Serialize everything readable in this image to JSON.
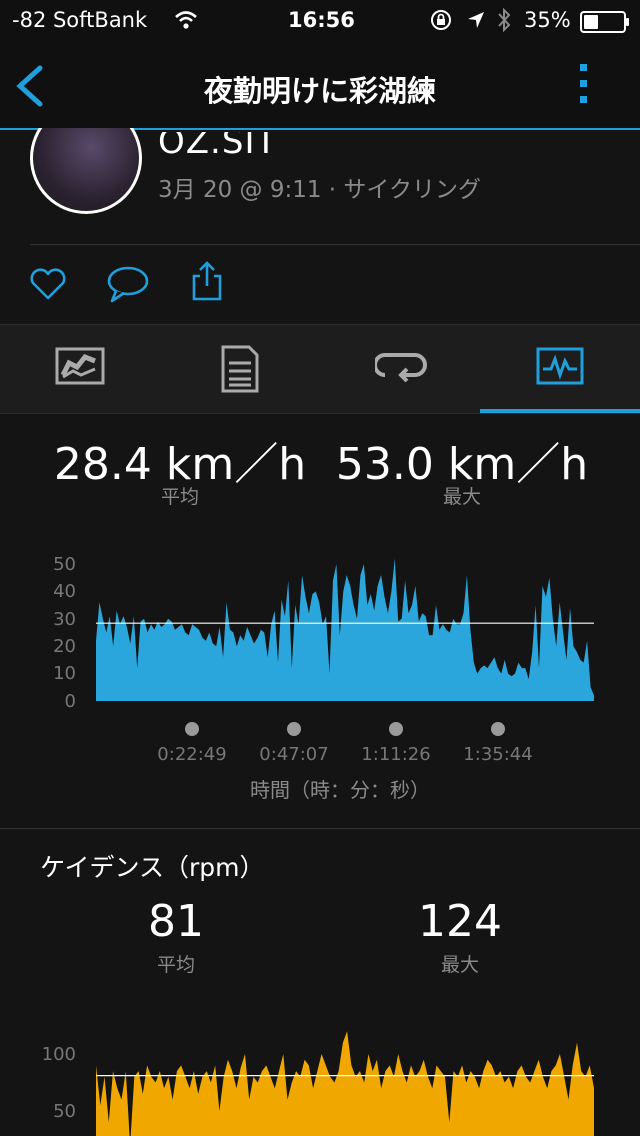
{
  "status_bar": {
    "carrier": "-82 SoftBank",
    "time": "16:56",
    "battery": "35%"
  },
  "nav": {
    "title": "夜勤明けに彩湖練"
  },
  "activity": {
    "user_name": "OZ.SIT",
    "meta": "3月 20 @ 9:11 · サイクリング"
  },
  "tabs": [
    "summary",
    "details",
    "laps",
    "charts"
  ],
  "speed": {
    "avg_value": "28.4 km／h",
    "avg_label": "平均",
    "max_value": "53.0 km／h",
    "max_label": "最大",
    "y_ticks": [
      "50",
      "40",
      "30",
      "20",
      "10",
      "0"
    ],
    "x_ticks": [
      "0:22:49",
      "0:47:07",
      "1:11:26",
      "1:35:44"
    ],
    "x_axis_label": "時間（時：分：秒）",
    "color": "#2aa6dc"
  },
  "cadence": {
    "title": "ケイデンス（rpm）",
    "avg_value": "81",
    "avg_label": "平均",
    "max_value": "124",
    "max_label": "最大",
    "y_ticks": [
      "100",
      "50"
    ],
    "color": "#f0a800"
  },
  "chart_data": [
    {
      "type": "area",
      "xlabel": "時間（時：分：秒）",
      "ylabel": "",
      "ylim": [
        0,
        55
      ],
      "x_ticks": [
        "0:22:49",
        "0:47:07",
        "1:11:26",
        "1:35:44"
      ],
      "average_line": 28.4,
      "y": [
        22,
        36,
        30,
        25,
        31,
        20,
        33,
        28,
        31,
        27,
        21,
        31,
        12,
        29,
        30,
        25,
        28,
        26,
        29,
        27,
        28,
        30,
        29,
        26,
        27,
        28,
        25,
        24,
        28,
        27,
        26,
        23,
        22,
        25,
        21,
        20,
        27,
        16,
        36,
        26,
        25,
        20,
        24,
        22,
        27,
        24,
        21,
        23,
        26,
        25,
        16,
        28,
        33,
        14,
        37,
        31,
        44,
        12,
        35,
        28,
        46,
        38,
        32,
        39,
        40,
        36,
        28,
        31,
        10,
        44,
        50,
        24,
        40,
        46,
        42,
        35,
        30,
        46,
        50,
        35,
        39,
        33,
        42,
        46,
        38,
        32,
        40,
        52,
        29,
        30,
        44,
        32,
        35,
        42,
        29,
        32,
        31,
        24,
        24,
        35,
        26,
        28,
        26,
        25,
        30,
        28,
        28,
        32,
        46,
        26,
        14,
        10,
        12,
        13,
        12,
        14,
        16,
        12,
        10,
        15,
        10,
        9,
        10,
        14,
        12,
        12,
        8,
        18,
        35,
        12,
        42,
        38,
        45,
        30,
        20,
        36,
        25,
        15,
        34,
        20,
        18,
        15,
        14,
        22,
        5,
        2
      ]
    },
    {
      "type": "area",
      "ylim": [
        0,
        130
      ],
      "average_line": 81,
      "y": [
        90,
        55,
        80,
        40,
        85,
        70,
        60,
        85,
        20,
        80,
        85,
        65,
        90,
        80,
        75,
        85,
        70,
        80,
        60,
        85,
        90,
        80,
        70,
        85,
        65,
        80,
        85,
        75,
        90,
        50,
        80,
        95,
        85,
        70,
        88,
        100,
        60,
        80,
        75,
        85,
        90,
        80,
        70,
        85,
        100,
        60,
        75,
        85,
        80,
        95,
        90,
        70,
        85,
        100,
        90,
        80,
        75,
        85,
        110,
        120,
        90,
        80,
        85,
        75,
        100,
        85,
        95,
        70,
        85,
        90,
        80,
        100,
        85,
        75,
        90,
        80,
        85,
        95,
        80,
        70,
        90,
        85,
        80,
        40,
        85,
        80,
        90,
        75,
        85,
        80,
        70,
        85,
        95,
        90,
        80,
        85,
        75,
        80,
        70,
        85,
        90,
        80,
        75,
        85,
        95,
        80,
        70,
        85,
        90,
        100,
        80,
        60,
        90,
        110,
        85,
        80,
        90,
        70
      ]
    }
  ]
}
